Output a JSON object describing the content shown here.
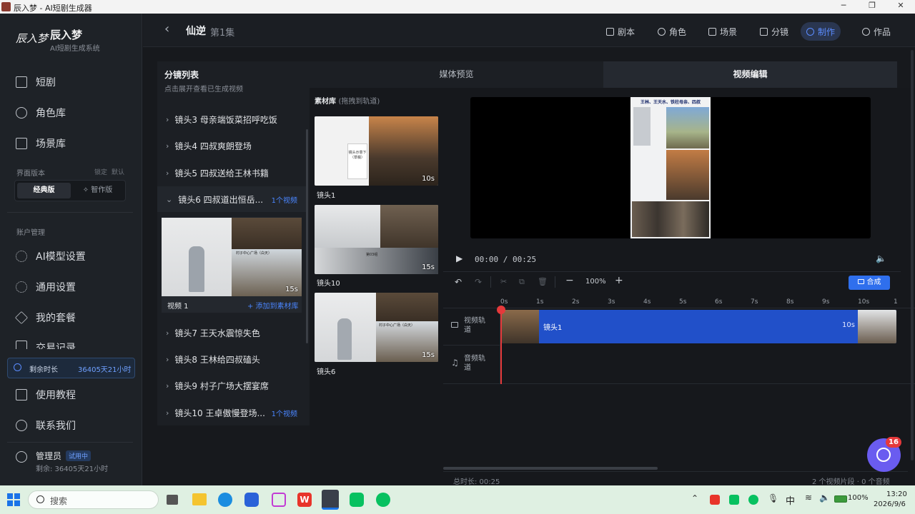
{
  "window": {
    "title": "AI短剧生成器",
    "app_name": "辰入梦"
  },
  "sidebar": {
    "logo_text": "辰入梦",
    "title": "辰入梦",
    "subtitle": "AI短剧生成系统",
    "nav_top": [
      {
        "label": "短剧",
        "icon": "film-icon"
      },
      {
        "label": "角色库",
        "icon": "user-icon"
      },
      {
        "label": "场景库",
        "icon": "image-icon"
      }
    ],
    "ui_version_label": "界面版本",
    "ui_version_right": [
      "锁定",
      "默认"
    ],
    "segment": {
      "classic": "经典版",
      "smart": "✧ 智作版"
    },
    "account_label": "账户管理",
    "nav_account": [
      {
        "label": "AI模型设置",
        "icon": "gear-icon"
      },
      {
        "label": "通用设置",
        "icon": "gear-icon"
      },
      {
        "label": "我的套餐",
        "icon": "package-icon"
      },
      {
        "label": "交易记录",
        "icon": "receipt-icon"
      }
    ],
    "remain": {
      "label": "剩余时长",
      "value": "36405天21小时"
    },
    "nav_bottom": [
      {
        "label": "使用教程",
        "icon": "book-icon"
      },
      {
        "label": "联系我们",
        "icon": "chat-icon"
      }
    ],
    "user": {
      "name": "管理员",
      "badge": "试用中",
      "remain": "剩余: 36405天21小时"
    }
  },
  "header": {
    "back": "‹",
    "title": "仙逆",
    "episode": "第1集",
    "nav": [
      {
        "label": "剧本",
        "icon": "doc-icon"
      },
      {
        "label": "角色",
        "icon": "user-icon"
      },
      {
        "label": "场景",
        "icon": "image-icon"
      },
      {
        "label": "分镜",
        "icon": "film-icon"
      },
      {
        "label": "制作",
        "icon": "gear-icon"
      },
      {
        "label": "作品",
        "icon": "play-circle-icon"
      }
    ],
    "active": "制作"
  },
  "shotlist": {
    "title": "分镜列表",
    "hint": "点击展开查看已生成视频",
    "items": [
      {
        "label": "镜头3 母亲端饭菜招呼吃饭",
        "badge": ""
      },
      {
        "label": "镜头4 四叔爽朗登场",
        "badge": ""
      },
      {
        "label": "镜头5 四叔送给王林书籍",
        "badge": ""
      },
      {
        "label": "镜头6 四叔道出恒岳...",
        "badge": "1个视频"
      },
      {
        "label": "镜头7 王天水震惊失色",
        "badge": ""
      },
      {
        "label": "镜头8 王林给四叔磕头",
        "badge": ""
      },
      {
        "label": "镜头9 村子广场大摆宴席",
        "badge": ""
      },
      {
        "label": "镜头10 王卓傲慢登场...",
        "badge": "1个视频"
      }
    ],
    "expanded_video": {
      "name": "视频 1",
      "duration": "15s",
      "add": "+ 添加到素材库",
      "sign": "村子中心广场（白天）"
    }
  },
  "tabs": {
    "media_preview": "媒体预览",
    "video_edit": "视频编辑"
  },
  "library": {
    "title": "素材库",
    "hint": "(拖拽到轨道)",
    "items": [
      {
        "label": "镜头1",
        "duration": "10s",
        "note": "镜头示意下（草稿）"
      },
      {
        "label": "镜头10",
        "duration": "15s",
        "note": "第03组"
      },
      {
        "label": "镜头6",
        "duration": "15s",
        "note": "村子中心广场（白天）"
      }
    ]
  },
  "preview": {
    "caption": "王林、王天水、铁柱母亲、四叔"
  },
  "player": {
    "current": "00:00",
    "separator": "/",
    "total": "00:25"
  },
  "toolbar": {
    "zoom": "100%",
    "compose": "合成"
  },
  "timeline": {
    "ticks": [
      "0s",
      "1s",
      "2s",
      "3s",
      "4s",
      "5s",
      "6s",
      "7s",
      "8s",
      "9s",
      "10s",
      "1"
    ],
    "video_track": "视频轨道",
    "audio_track": "音频轨道",
    "clip": {
      "label": "镜头1",
      "duration": "10s"
    }
  },
  "footer": {
    "total": "总时长: 00:25",
    "counts": "2 个视频片段 · 0 个音频"
  },
  "chat_fab": {
    "count": "16"
  },
  "taskbar": {
    "search": "搜索",
    "ime": "中",
    "battery": "100%",
    "time": "13:20",
    "date": "2026/9/6"
  },
  "colors": {
    "accent": "#2f6fed",
    "clip": "#2150c9",
    "playhead": "#e5393b",
    "taskbar": "#dff0e2"
  }
}
